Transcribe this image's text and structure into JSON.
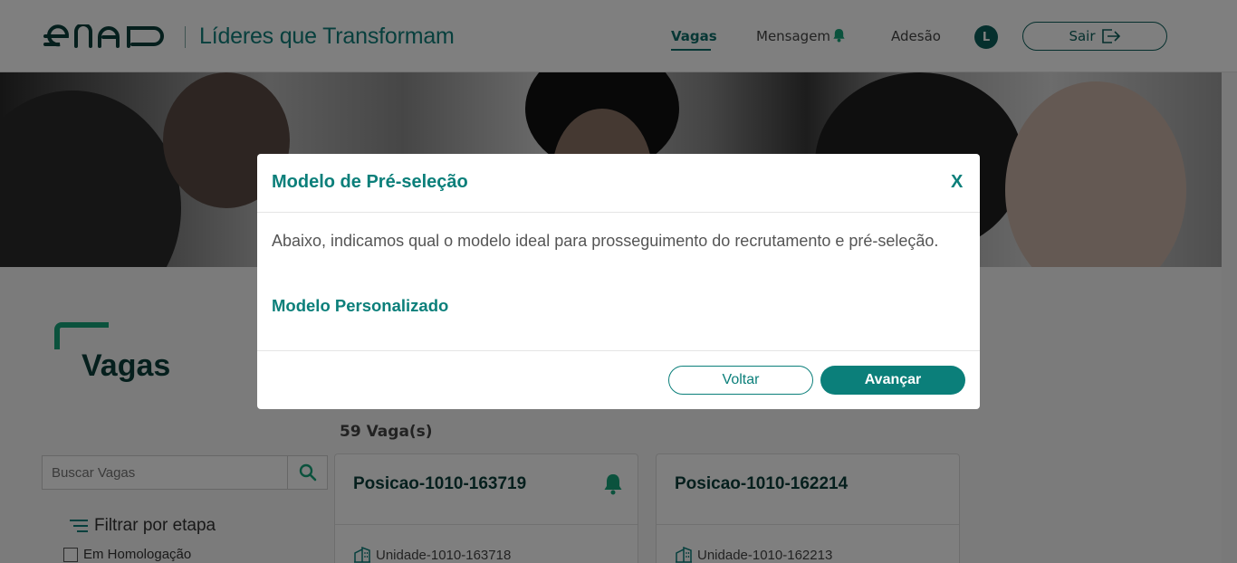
{
  "header": {
    "brand_logo_text": "enap",
    "brand_title": "Líderes que Transformam",
    "nav": {
      "vagas": "Vagas",
      "mensagem": "Mensagem",
      "adesao": "Adesão"
    },
    "avatar_initial": "L",
    "logout_label": "Sair"
  },
  "page": {
    "title": "Vagas",
    "count_label": "59 Vaga(s)",
    "search": {
      "placeholder": "Buscar Vagas"
    },
    "filter": {
      "label": "Filtrar por etapa",
      "options": [
        {
          "label": "Em Homologação",
          "checked": false
        }
      ]
    },
    "cards": [
      {
        "title": "Posicao-1010-163719",
        "unit": "Unidade-1010-163718",
        "has_alert_icon": true
      },
      {
        "title": "Posicao-1010-162214",
        "unit": "Unidade-1010-162213",
        "has_alert_icon": false
      }
    ]
  },
  "modal": {
    "title": "Modelo de Pré-seleção",
    "close_label": "X",
    "body_text": "Abaixo, indicamos qual o modelo ideal para prosseguimento do recrutamento e pré-seleção.",
    "model_name": "Modelo Personalizado",
    "back_label": "Voltar",
    "next_label": "Avançar"
  },
  "colors": {
    "brand_teal": "#0b7f7a",
    "dark_teal": "#0b5f5a",
    "accent_green": "#16a57a",
    "bell_green": "#16a57a"
  },
  "icons": {
    "bell": "bell-icon",
    "logout": "logout-icon",
    "search": "search-icon",
    "filter": "filter-lines-icon",
    "building": "building-icon"
  }
}
